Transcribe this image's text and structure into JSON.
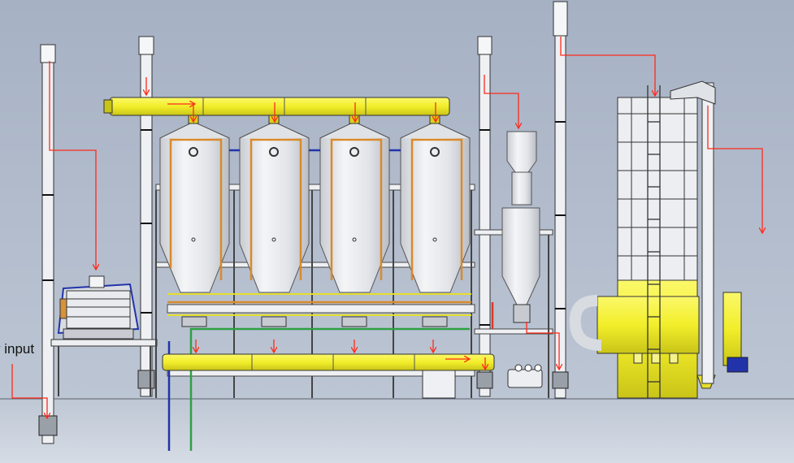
{
  "labels": {
    "input": "y input"
  },
  "colors": {
    "background_top": "#a8b3c5",
    "background_bottom": "#d4dae4",
    "ground_line": "#5a6170",
    "yellow": "#f2ee2a",
    "silver": "#e7e9ed",
    "arrow_red": "#ff2a1a",
    "pipe_blue": "#2233aa",
    "pipe_green": "#2ea043",
    "pipe_orange": "#d98a2b"
  },
  "icons": [
    "flow-arrow-icon"
  ]
}
